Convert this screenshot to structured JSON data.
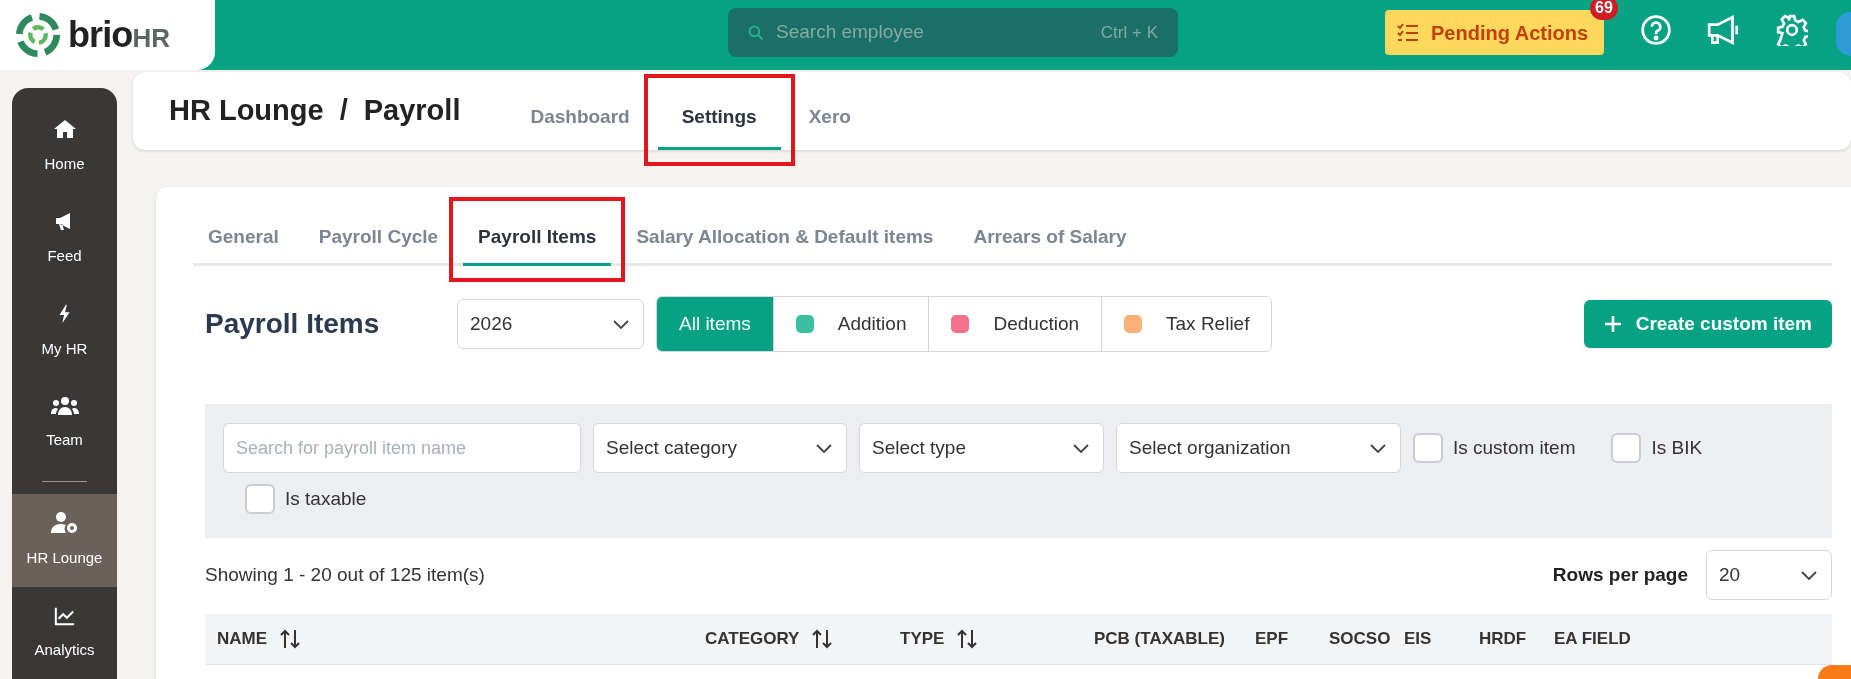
{
  "logo": {
    "text_main": "brio",
    "text_accent": "HR"
  },
  "top_bar": {
    "search": {
      "placeholder": "Search employee",
      "shortcut": "Ctrl + K"
    },
    "pending_actions": {
      "label": "Pending Actions",
      "badge": "69"
    }
  },
  "sidebar": {
    "items": [
      {
        "label": "Home",
        "kind": "home",
        "selected": false
      },
      {
        "label": "Feed",
        "kind": "feed",
        "selected": false
      },
      {
        "label": "My HR",
        "kind": "bolt",
        "selected": false
      },
      {
        "label": "Team",
        "kind": "team",
        "selected": false
      },
      {
        "label": "HR Lounge",
        "kind": "lounge",
        "selected": true
      },
      {
        "label": "Analytics",
        "kind": "chart",
        "selected": false
      }
    ]
  },
  "header": {
    "breadcrumb": [
      "HR Lounge",
      "Payroll"
    ],
    "separator": "/",
    "tabs": [
      {
        "label": "Dashboard",
        "selected": false,
        "highlighted": false
      },
      {
        "label": "Settings",
        "selected": true,
        "highlighted": true
      },
      {
        "label": "Xero",
        "selected": false,
        "highlighted": false
      }
    ]
  },
  "sub_tabs": [
    {
      "label": "General",
      "selected": false,
      "highlighted": false
    },
    {
      "label": "Payroll Cycle",
      "selected": false,
      "highlighted": false
    },
    {
      "label": "Payroll Items",
      "selected": true,
      "highlighted": true
    },
    {
      "label": "Salary Allocation & Default items",
      "selected": false,
      "highlighted": false
    },
    {
      "label": "Arrears of Salary",
      "selected": false,
      "highlighted": false
    }
  ],
  "section": {
    "title": "Payroll Items",
    "year": "2026",
    "item_types": [
      {
        "label": "All items",
        "selected": true
      },
      {
        "label": "Addition",
        "selected": false,
        "color": "#3cbfa0"
      },
      {
        "label": "Deduction",
        "selected": false,
        "color": "#f4728a"
      },
      {
        "label": "Tax Relief",
        "selected": false,
        "color": "#fdb07a"
      }
    ],
    "create_button": "Create custom item"
  },
  "filters": {
    "search_placeholder": "Search for payroll item name",
    "selects": [
      "Select category",
      "Select type",
      "Select organization"
    ],
    "checkboxes": [
      {
        "label": "Is custom item",
        "checked": false
      },
      {
        "label": "Is BIK",
        "checked": false
      },
      {
        "label": "Is taxable",
        "checked": false
      }
    ]
  },
  "summary": "Showing 1 - 20 out of 125 item(s)",
  "rows_per_page": {
    "label": "Rows per page",
    "value": "20"
  },
  "table": {
    "columns": [
      {
        "label": "NAME",
        "sortable": true
      },
      {
        "label": "CATEGORY",
        "sortable": true
      },
      {
        "label": "TYPE",
        "sortable": true
      },
      {
        "label": "PCB (TAXABLE)",
        "sortable": false
      },
      {
        "label": "EPF",
        "sortable": false
      },
      {
        "label": "SOCSO",
        "sortable": false
      },
      {
        "label": "EIS",
        "sortable": false
      },
      {
        "label": "HRDF",
        "sortable": false
      },
      {
        "label": "EA FIELD",
        "sortable": false
      }
    ]
  }
}
